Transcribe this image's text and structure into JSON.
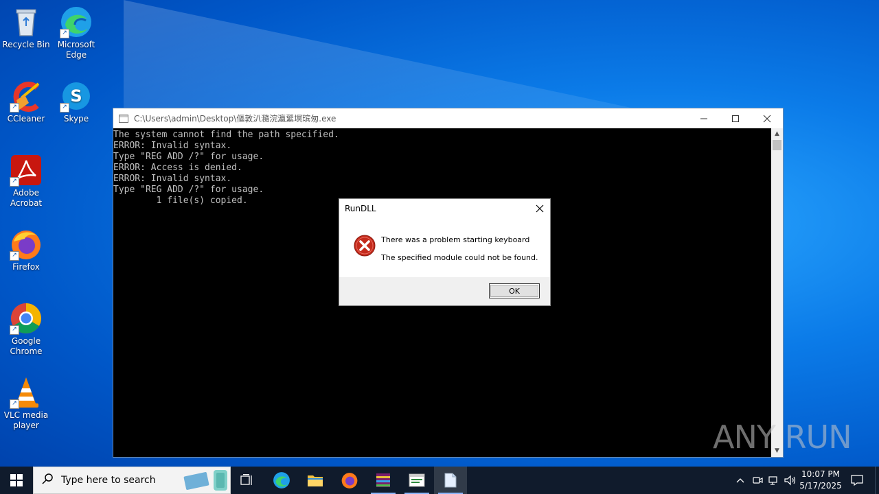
{
  "desktop": {
    "icons": [
      {
        "label": "Recycle Bin"
      },
      {
        "label": "Microsoft Edge"
      },
      {
        "label": "CCleaner"
      },
      {
        "label": "Skype"
      },
      {
        "label": "Adobe Acrobat"
      },
      {
        "label": "Firefox"
      },
      {
        "label": "Google Chrome"
      },
      {
        "label": "VLC media player"
      }
    ]
  },
  "console": {
    "title": "C:\\Users\\admin\\Desktop\\傴敦汃瀡浣瀛綤塓瑸匆.exe",
    "lines": [
      "The system cannot find the path specified.",
      "ERROR: Invalid syntax.",
      "Type \"REG ADD /?\" for usage.",
      "ERROR: Access is denied.",
      "ERROR: Invalid syntax.",
      "Type \"REG ADD /?\" for usage.",
      "        1 file(s) copied."
    ]
  },
  "dialog": {
    "title": "RunDLL",
    "message1": "There was a problem starting keyboard",
    "message2": "The specified module could not be found.",
    "ok_label": "OK",
    "icon": "error-icon"
  },
  "watermark": {
    "text": "ANY RUN"
  },
  "taskbar": {
    "search_placeholder": "Type here to search",
    "apps": [
      "task-view",
      "edge",
      "file-explorer",
      "firefox",
      "winrar",
      "console-app",
      "notepad"
    ],
    "clock_time": "10:07 PM",
    "clock_date": "5/17/2025"
  },
  "colors": {
    "accent": "#0078d7",
    "taskbar": "#101b2c",
    "console_bg": "#000000",
    "console_fg": "#c0c0c0"
  }
}
